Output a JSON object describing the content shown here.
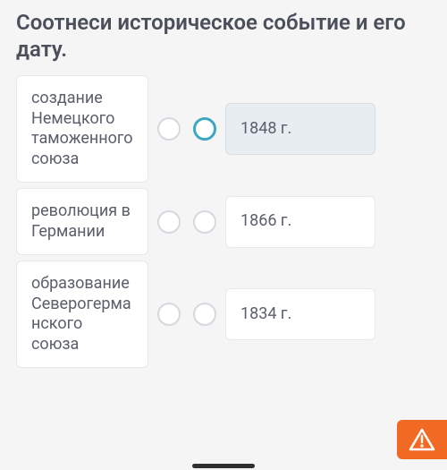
{
  "title": "Соотнеси историческое событие и его дату.",
  "rows": [
    {
      "left": "создание Немецкого таможенного союза",
      "right": "1848 г.",
      "right_selected": true
    },
    {
      "left": "революция в Германии",
      "right": "1866 г.",
      "right_selected": false
    },
    {
      "left": "образование Северогерманского союза",
      "right": "1834 г.",
      "right_selected": false
    }
  ],
  "icons": {
    "warning": "warning-triangle"
  }
}
